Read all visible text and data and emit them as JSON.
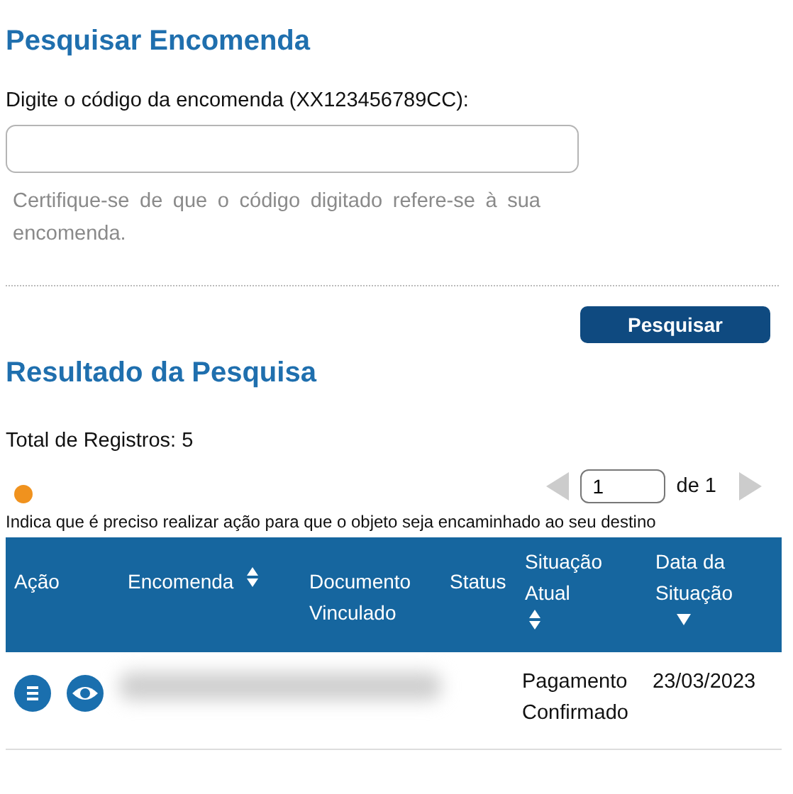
{
  "search": {
    "title": "Pesquisar Encomenda",
    "label": "Digite o código da encomenda (XX123456789CC):",
    "hint": "Certifique-se de que o código digitado refere-se à sua encomenda.",
    "button": "Pesquisar"
  },
  "results": {
    "title": "Resultado da Pesquisa",
    "total": "Total de Registros: 5",
    "legend": {
      "color": "#f0921e",
      "text": "Indica que é preciso realizar ação para que o objeto seja encaminhado ao seu destino"
    },
    "pager": {
      "page": "1",
      "of": "de 1"
    },
    "table": {
      "columns": [
        {
          "label": "Ação",
          "kind": "plain"
        },
        {
          "label": "Encomenda",
          "kind": "sortable"
        },
        {
          "label": "Documento Vinculado",
          "kind": "plain"
        },
        {
          "label": "Status",
          "kind": "plain"
        },
        {
          "label": "Situação Atual",
          "kind": "sortable"
        },
        {
          "label": "Data da Situação",
          "kind": "descending"
        }
      ],
      "rows": [
        {
          "situacao": "Pagamento Confirmado",
          "data": "23/03/2023"
        }
      ]
    }
  }
}
